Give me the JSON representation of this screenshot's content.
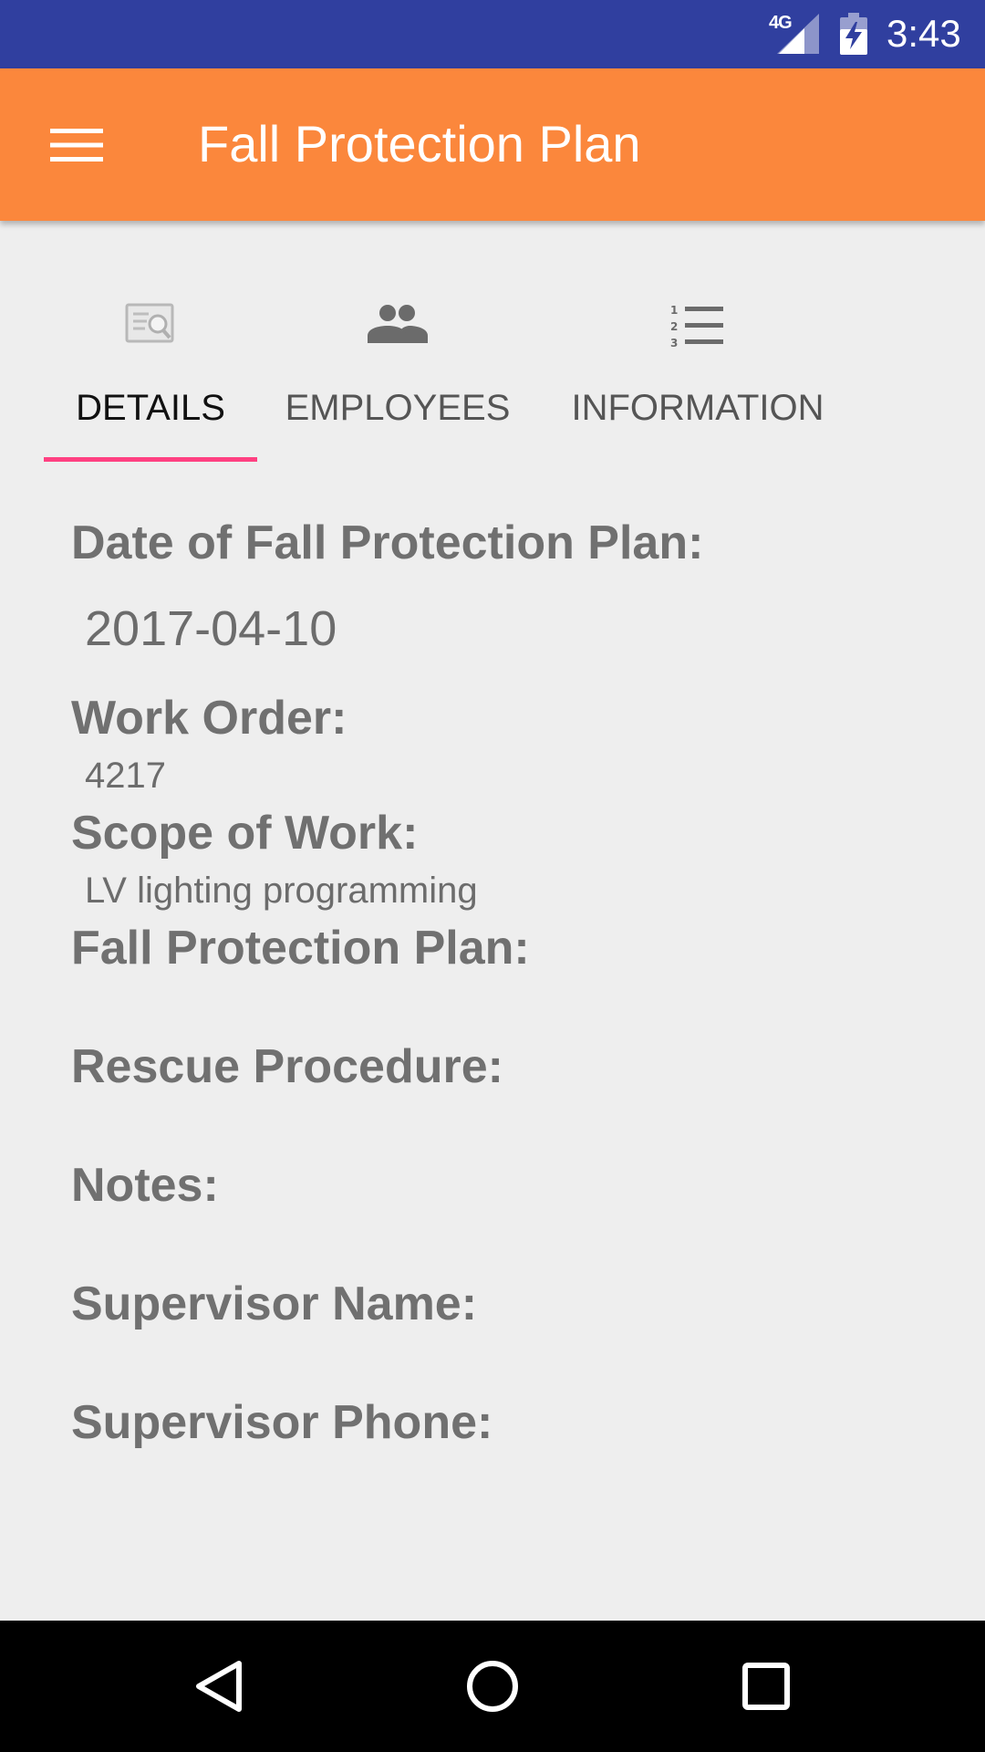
{
  "status_bar": {
    "network": "4G",
    "time": "3:43"
  },
  "app_bar": {
    "title": "Fall Protection Plan",
    "menu_icon": "hamburger-menu-icon"
  },
  "tabs": [
    {
      "label": "DETAILS",
      "icon": "document-search-icon",
      "selected": true
    },
    {
      "label": "EMPLOYEES",
      "icon": "people-icon",
      "selected": false
    },
    {
      "label": "INFORMATION",
      "icon": "numbered-list-icon",
      "selected": false
    }
  ],
  "details": {
    "date_label": "Date of Fall Protection Plan:",
    "date_value": "2017-04-10",
    "work_order_label": "Work Order:",
    "work_order_value": "4217",
    "scope_label": "Scope of Work:",
    "scope_value": "LV lighting programming",
    "plan_label": "Fall Protection Plan:",
    "plan_value": "",
    "rescue_label": "Rescue Procedure:",
    "rescue_value": "",
    "notes_label": "Notes:",
    "notes_value": "",
    "supervisor_name_label": "Supervisor Name:",
    "supervisor_name_value": "",
    "supervisor_phone_label": "Supervisor Phone:",
    "supervisor_phone_value": ""
  },
  "colors": {
    "status_bar": "#303f9f",
    "app_bar": "#fb873c",
    "tab_indicator": "#ff4081",
    "background": "#eeeeee",
    "label_text": "#707070"
  }
}
